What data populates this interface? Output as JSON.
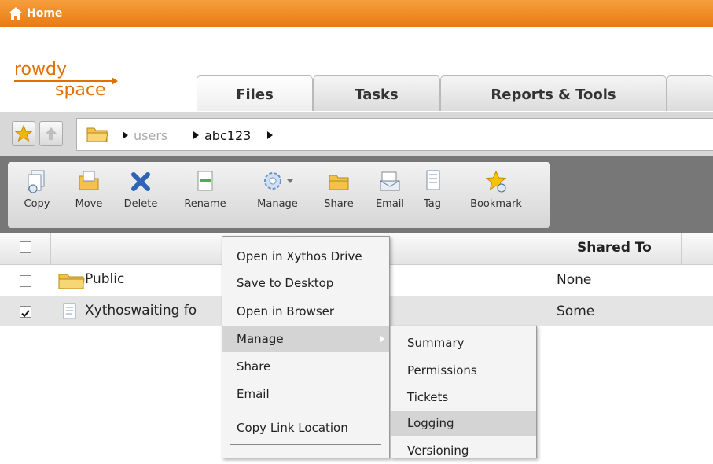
{
  "topbar": {
    "title": "Home",
    "icon": "home-icon",
    "color": "#f08a20"
  },
  "logo": {
    "line1": "rowdy",
    "line2": "space",
    "color": "#e07000"
  },
  "tabs": [
    {
      "label": "Files",
      "active": true
    },
    {
      "label": "Tasks",
      "active": false
    },
    {
      "label": "Reports & Tools",
      "active": false
    }
  ],
  "path": {
    "segments": [
      "users",
      "abc123"
    ]
  },
  "toolbar": {
    "items": [
      {
        "label": "Copy",
        "icon": "copy-icon"
      },
      {
        "label": "Move",
        "icon": "move-icon"
      },
      {
        "label": "Delete",
        "icon": "delete-icon"
      },
      {
        "label": "Rename",
        "icon": "rename-icon"
      },
      {
        "label": "Manage",
        "icon": "manage-gear-icon"
      },
      {
        "label": "Share",
        "icon": "share-icon"
      },
      {
        "label": "Email",
        "icon": "email-icon"
      },
      {
        "label": "Tag",
        "icon": "tag-icon"
      },
      {
        "label": "Bookmark",
        "icon": "bookmark-star-icon"
      }
    ]
  },
  "table": {
    "columns": {
      "shared_to": "Shared To"
    },
    "rows": [
      {
        "name": "Public",
        "shared": "None",
        "checked": false,
        "icon": "folder-icon"
      },
      {
        "name": "Xythoswaiting fo",
        "shared": "Some",
        "checked": true,
        "icon": "document-icon"
      }
    ]
  },
  "context_menu": {
    "items": [
      {
        "label": "Open in Xythos Drive"
      },
      {
        "label": "Save to Desktop"
      },
      {
        "label": "Open in Browser"
      },
      {
        "label": "Manage",
        "highlighted": true,
        "has_submenu": true
      },
      {
        "label": "Share"
      },
      {
        "label": "Email"
      },
      {
        "label": "Copy Link Location"
      }
    ]
  },
  "submenu": {
    "items": [
      {
        "label": "Summary"
      },
      {
        "label": "Permissions"
      },
      {
        "label": "Tickets"
      },
      {
        "label": "Logging",
        "highlighted": true
      },
      {
        "label": "Versioning"
      }
    ]
  }
}
